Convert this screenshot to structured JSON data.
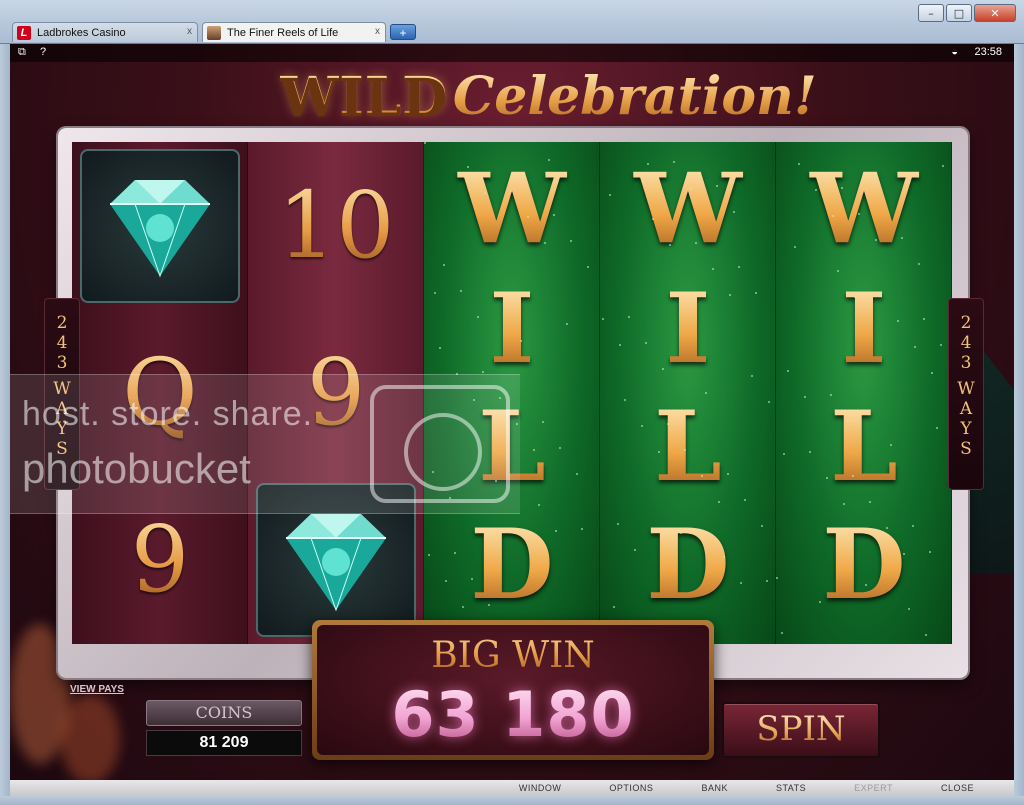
{
  "browser": {
    "tabs": [
      {
        "label": "Ladbrokes Casino",
        "icon": "ladbrokes-logo-icon",
        "icon_letter": "L"
      },
      {
        "label": "The Finer Reels of Life",
        "icon": "casino-tab-icon"
      }
    ],
    "tab_close": "x",
    "new_tab": "+",
    "window_buttons": {
      "minimize": "–",
      "maximize": "□",
      "close": "✕"
    }
  },
  "toolbar": {
    "help": "?",
    "time": "23:58"
  },
  "game": {
    "title_wild": "WILD",
    "title_celebration": "Celebration!",
    "ways": {
      "digits": [
        "2",
        "4",
        "3"
      ],
      "label": [
        "W",
        "A",
        "Y",
        "S"
      ]
    },
    "reels": [
      [
        "diamond",
        "Q",
        "9"
      ],
      [
        "10",
        "9",
        "diamond"
      ],
      [
        "WILD"
      ],
      [
        "WILD"
      ],
      [
        "WILD"
      ]
    ],
    "wild_letters": [
      "W",
      "I",
      "L",
      "D"
    ],
    "symbols": {
      "reel1_mid": "Q",
      "reel1_bottom": "9",
      "reel2_top": "10",
      "reel2_mid": "9"
    }
  },
  "watermark": {
    "line1": "host. store. share.",
    "line2": "photobucket"
  },
  "panel": {
    "view_pays": "VIEW PAYS",
    "coins_label": "COINS",
    "coins_value": "81 209",
    "big_win_label": "BIG WIN",
    "big_win_value": "63 180",
    "spin_label": "SPIN"
  },
  "bottom_menu": [
    {
      "label": "WINDOW",
      "enabled": true
    },
    {
      "label": "OPTIONS",
      "enabled": true
    },
    {
      "label": "BANK",
      "enabled": true
    },
    {
      "label": "STATS",
      "enabled": true
    },
    {
      "label": "EXPERT",
      "enabled": false
    },
    {
      "label": "CLOSE",
      "enabled": true
    }
  ],
  "colors": {
    "gold": "#f0b868",
    "wild_green": "#0f6a28",
    "reel_red": "#5a1a2c",
    "big_win_pink": "#f2a3d3"
  }
}
